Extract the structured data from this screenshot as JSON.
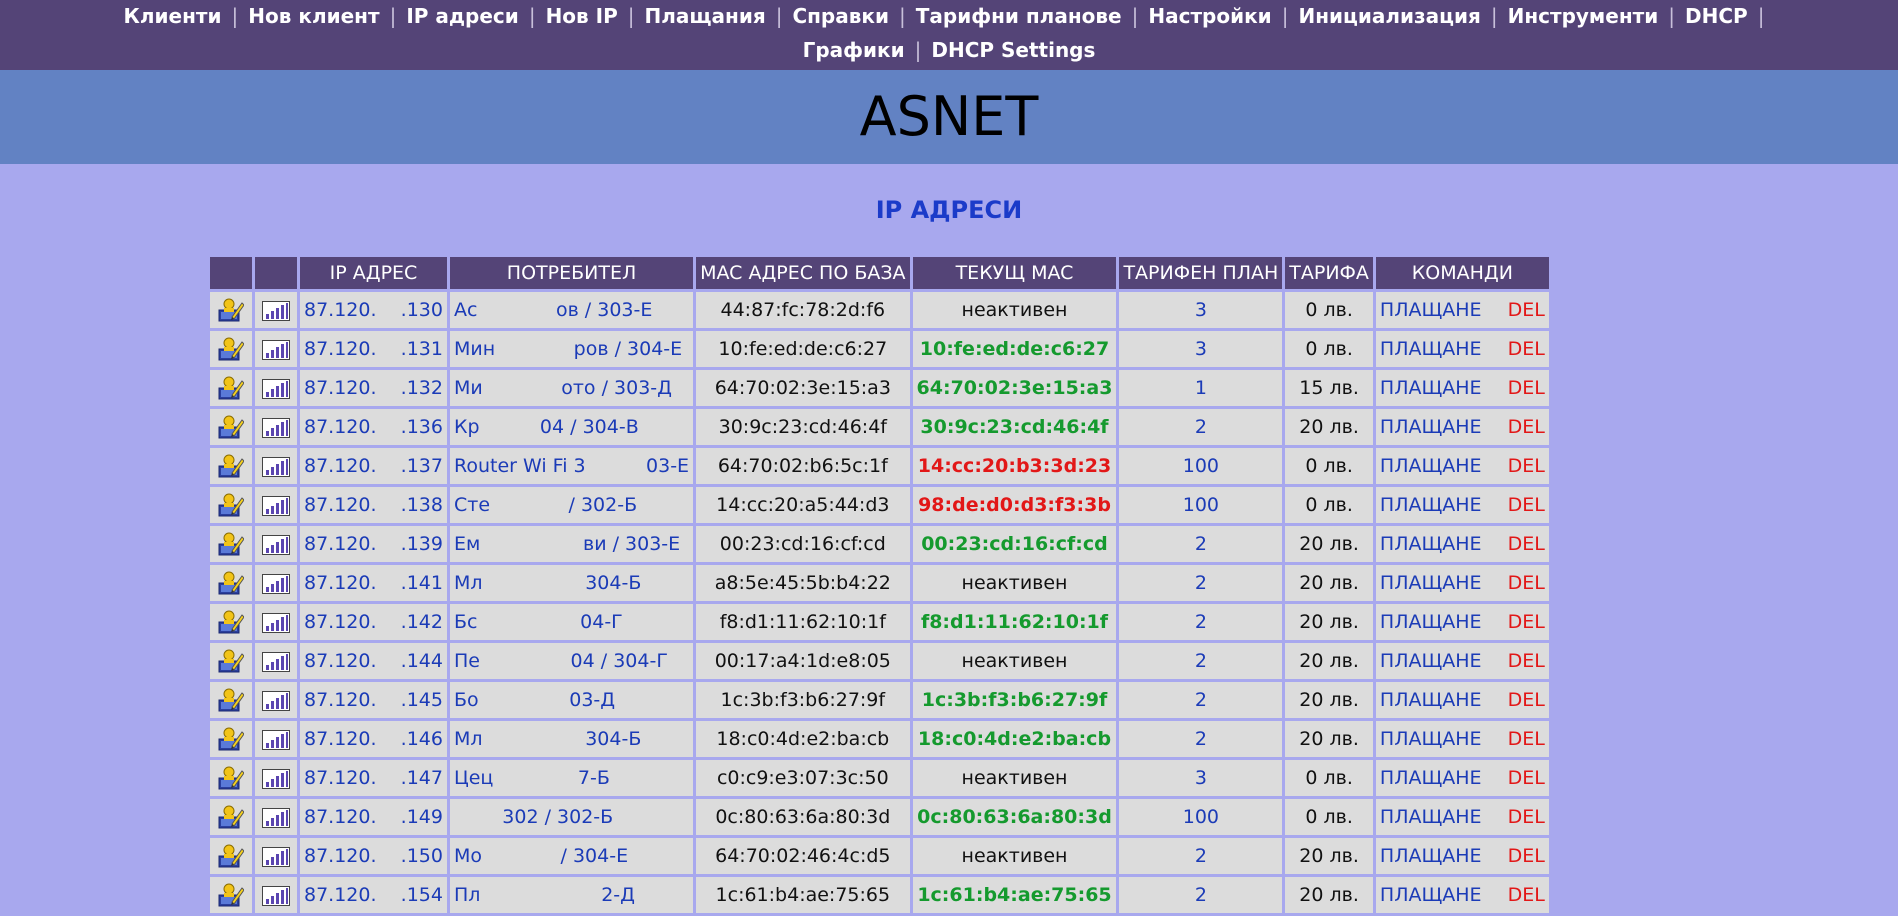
{
  "nav": {
    "row1": [
      "Клиенти",
      "Нов клиент",
      "IP адреси",
      "Нов IP",
      "Плащания",
      "Справки",
      "Тарифни планове",
      "Настройки",
      "Инициализация",
      "Инструменти",
      "DHCP"
    ],
    "row2": [
      "Графики",
      "DHCP Settings"
    ]
  },
  "banner": {
    "title": "ASNET"
  },
  "page": {
    "title": "IP АДРЕСИ"
  },
  "table": {
    "headers": [
      "",
      "",
      "IP АДРЕС",
      "ПОТРЕБИТЕЛ",
      "MAC АДРЕС ПО БАЗА",
      "ТЕКУЩ MAC",
      "ТАРИФЕН ПЛАН",
      "ТАРИФА",
      "КОМАНДИ"
    ],
    "pay_label": "ПЛАЩАНЕ",
    "del_label": "DEL",
    "icons": {
      "edit": "edit-user-icon",
      "stats": "bar-chart-icon"
    },
    "rows": [
      {
        "ip": "87.120.    .130",
        "user": "Ас             ов / 303-Е",
        "mac": "44:87:fc:78:2d:f6",
        "current": "неактивен",
        "status": "inactive",
        "plan": "3",
        "price": "0 лв."
      },
      {
        "ip": "87.120.    .131",
        "user": "Мин             ров / 304-Е",
        "mac": "10:fe:ed:de:c6:27",
        "current": "10:fe:ed:de:c6:27",
        "status": "match",
        "plan": "3",
        "price": "0 лв."
      },
      {
        "ip": "87.120.    .132",
        "user": "Ми             ото / 303-Д",
        "mac": "64:70:02:3e:15:a3",
        "current": "64:70:02:3e:15:a3",
        "status": "match",
        "plan": "1",
        "price": "15 лв."
      },
      {
        "ip": "87.120.    .136",
        "user": "Кр          04 / 304-В",
        "mac": "30:9c:23:cd:46:4f",
        "current": "30:9c:23:cd:46:4f",
        "status": "match",
        "plan": "2",
        "price": "20 лв."
      },
      {
        "ip": "87.120.    .137",
        "user": "Router Wi Fi 3          03-Е",
        "mac": "64:70:02:b6:5c:1f",
        "current": "14:cc:20:b3:3d:23",
        "status": "mismatch",
        "plan": "100",
        "price": "0 лв."
      },
      {
        "ip": "87.120.    .138",
        "user": "Сте             / 302-Б",
        "mac": "14:cc:20:a5:44:d3",
        "current": "98:de:d0:d3:f3:3b",
        "status": "mismatch",
        "plan": "100",
        "price": "0 лв."
      },
      {
        "ip": "87.120.    .139",
        "user": "Ем                 ви / 303-Е",
        "mac": "00:23:cd:16:cf:cd",
        "current": "00:23:cd:16:cf:cd",
        "status": "match",
        "plan": "2",
        "price": "20 лв."
      },
      {
        "ip": "87.120.    .141",
        "user": "Мл                 304-Б",
        "mac": "a8:5e:45:5b:b4:22",
        "current": "неактивен",
        "status": "inactive",
        "plan": "2",
        "price": "20 лв."
      },
      {
        "ip": "87.120.    .142",
        "user": "Бс                 04-Г",
        "mac": "f8:d1:11:62:10:1f",
        "current": "f8:d1:11:62:10:1f",
        "status": "match",
        "plan": "2",
        "price": "20 лв."
      },
      {
        "ip": "87.120.    .144",
        "user": "Пе               04 / 304-Г",
        "mac": "00:17:a4:1d:e8:05",
        "current": "неактивен",
        "status": "inactive",
        "plan": "2",
        "price": "20 лв."
      },
      {
        "ip": "87.120.    .145",
        "user": "Бо               03-Д",
        "mac": "1c:3b:f3:b6:27:9f",
        "current": "1c:3b:f3:b6:27:9f",
        "status": "match",
        "plan": "2",
        "price": "20 лв."
      },
      {
        "ip": "87.120.    .146",
        "user": "Мл                 304-Б",
        "mac": "18:c0:4d:e2:ba:cb",
        "current": "18:c0:4d:e2:ba:cb",
        "status": "match",
        "plan": "2",
        "price": "20 лв."
      },
      {
        "ip": "87.120.    .147",
        "user": "Цец              7-Б",
        "mac": "c0:c9:e3:07:3c:50",
        "current": "неактивен",
        "status": "inactive",
        "plan": "3",
        "price": "0 лв."
      },
      {
        "ip": "87.120.    .149",
        "user": "        302 / 302-Б",
        "mac": "0c:80:63:6a:80:3d",
        "current": "0c:80:63:6a:80:3d",
        "status": "match",
        "plan": "100",
        "price": "0 лв."
      },
      {
        "ip": "87.120.    .150",
        "user": "Мо             / 304-Е",
        "mac": "64:70:02:46:4c:d5",
        "current": "неактивен",
        "status": "inactive",
        "plan": "2",
        "price": "20 лв."
      },
      {
        "ip": "87.120.    .154",
        "user": "Пл                    2-Д",
        "mac": "1c:61:b4:ae:75:65",
        "current": "1c:61:b4:ae:75:65",
        "status": "match",
        "plan": "2",
        "price": "20 лв."
      }
    ]
  },
  "colors": {
    "nav_bg": "#544477",
    "banner_bg": "#6282c3",
    "page_bg": "#a8a8ee",
    "link_blue": "#1b3bb7",
    "match_green": "#159a2e",
    "mismatch_red": "#e21717"
  }
}
